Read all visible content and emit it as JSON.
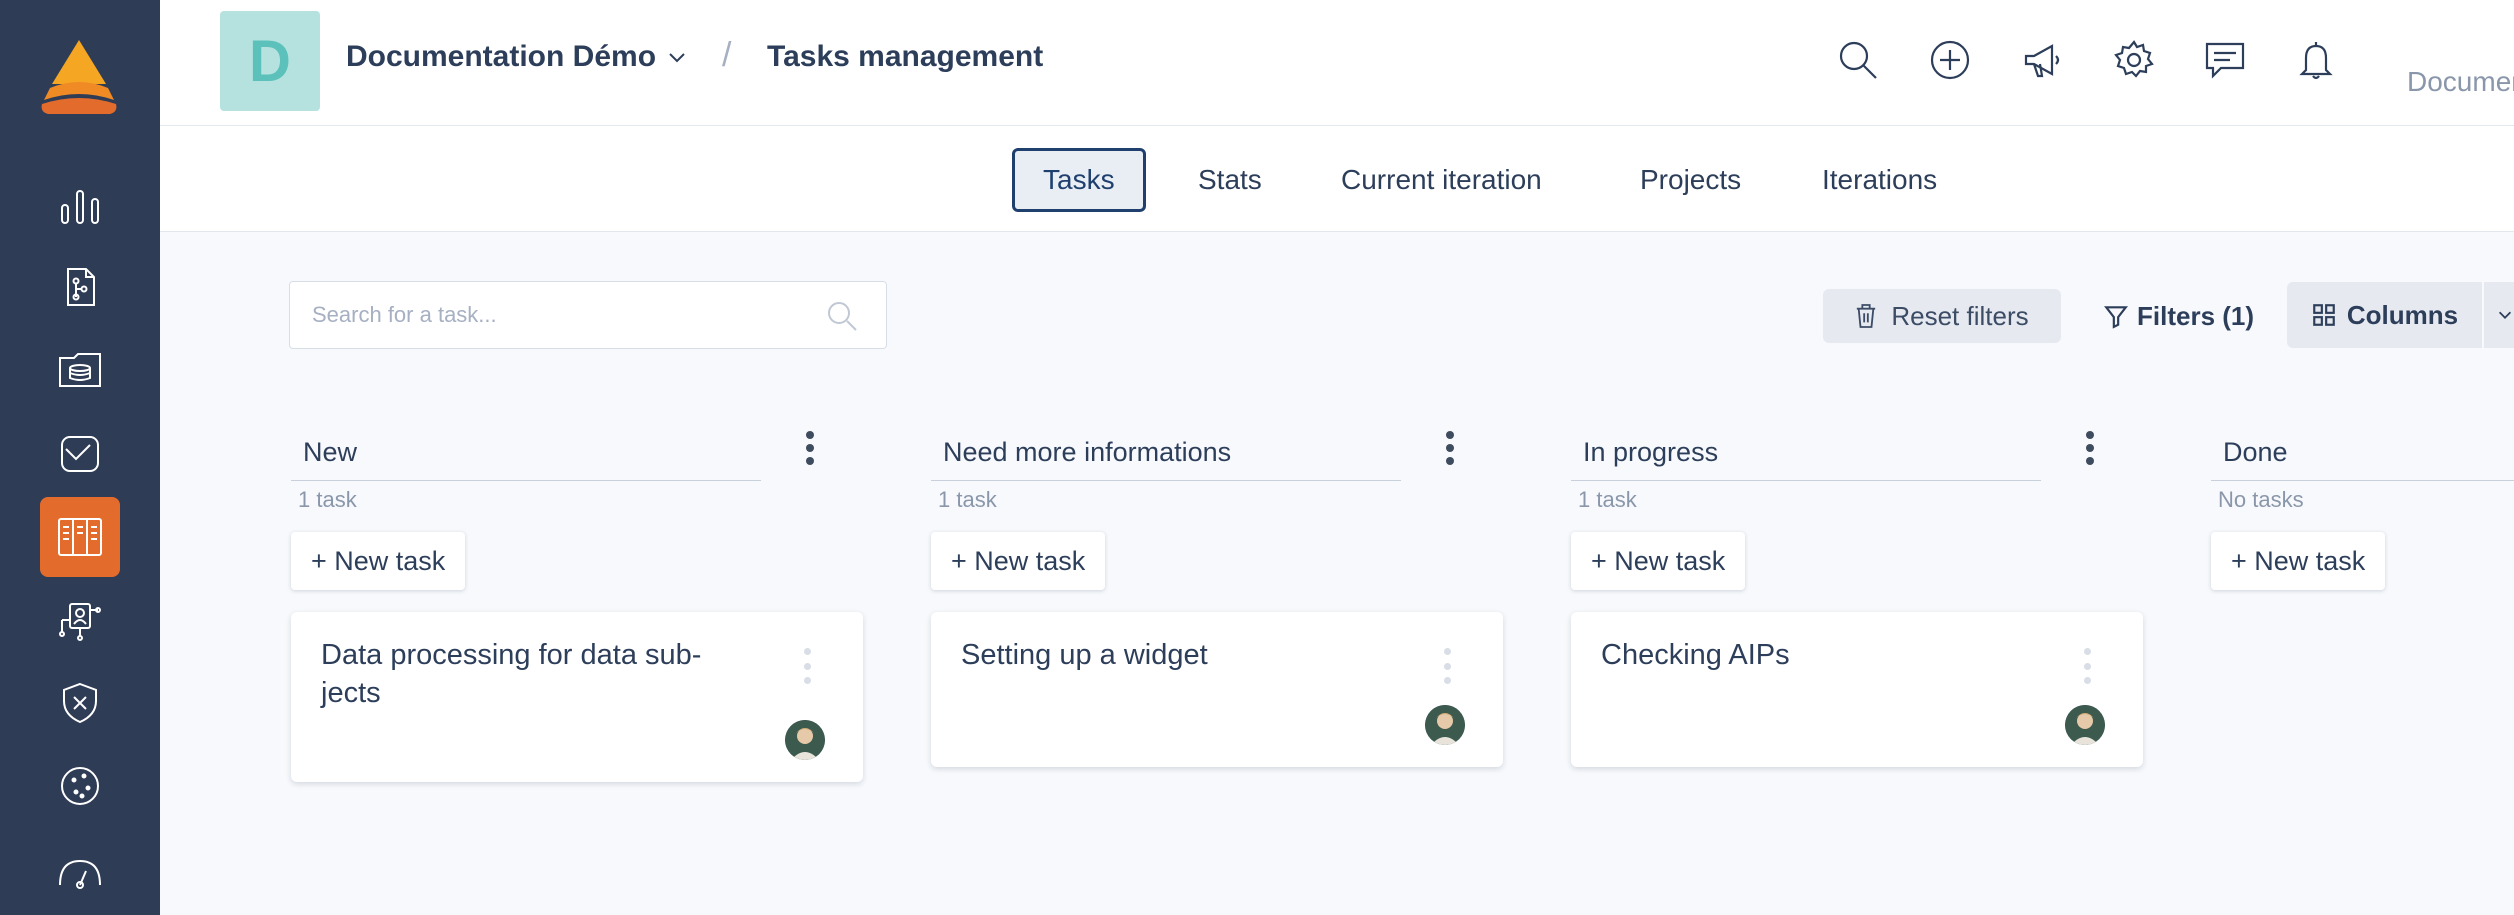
{
  "header": {
    "org_initial": "D",
    "org_name": "Documentation Démo",
    "breadcrumb_sep": "/",
    "page_title": "Tasks management",
    "user_label": "Documentation Démo"
  },
  "tabs": [
    {
      "label": "Tasks",
      "active": true
    },
    {
      "label": "Stats",
      "active": false
    },
    {
      "label": "Current iteration",
      "active": false
    },
    {
      "label": "Projects",
      "active": false
    },
    {
      "label": "Iterations",
      "active": false
    }
  ],
  "toolbar": {
    "search_placeholder": "Search for a task...",
    "reset_label": "Reset filters",
    "filters_label": "Filters (1)",
    "columns_label": "Columns"
  },
  "board": {
    "new_task_label": "+ New task",
    "columns": [
      {
        "title": "New",
        "count": "1 task",
        "cards": [
          {
            "title": "Data processing for data sub-jects"
          }
        ]
      },
      {
        "title": "Need more informations",
        "count": "1 task",
        "cards": [
          {
            "title": "Setting up a widget"
          }
        ]
      },
      {
        "title": "In progress",
        "count": "1 task",
        "cards": [
          {
            "title": "Checking AIPs"
          }
        ]
      },
      {
        "title": "Done",
        "count": "No tasks",
        "cards": []
      }
    ]
  },
  "sidebar": {
    "items": [
      {
        "icon": "bar-chart-icon"
      },
      {
        "icon": "document-tree-icon"
      },
      {
        "icon": "database-folder-icon"
      },
      {
        "icon": "checklist-icon"
      },
      {
        "icon": "kanban-board-icon",
        "active": true
      },
      {
        "icon": "user-network-icon"
      },
      {
        "icon": "shield-x-icon"
      },
      {
        "icon": "cookie-icon"
      },
      {
        "icon": "gauge-icon"
      }
    ]
  },
  "colors": {
    "sidebar_bg": "#2e3c56",
    "accent": "#e36b2b",
    "active_tab_border": "#1f3f6e",
    "org_avatar_bg": "#b5e2df"
  }
}
